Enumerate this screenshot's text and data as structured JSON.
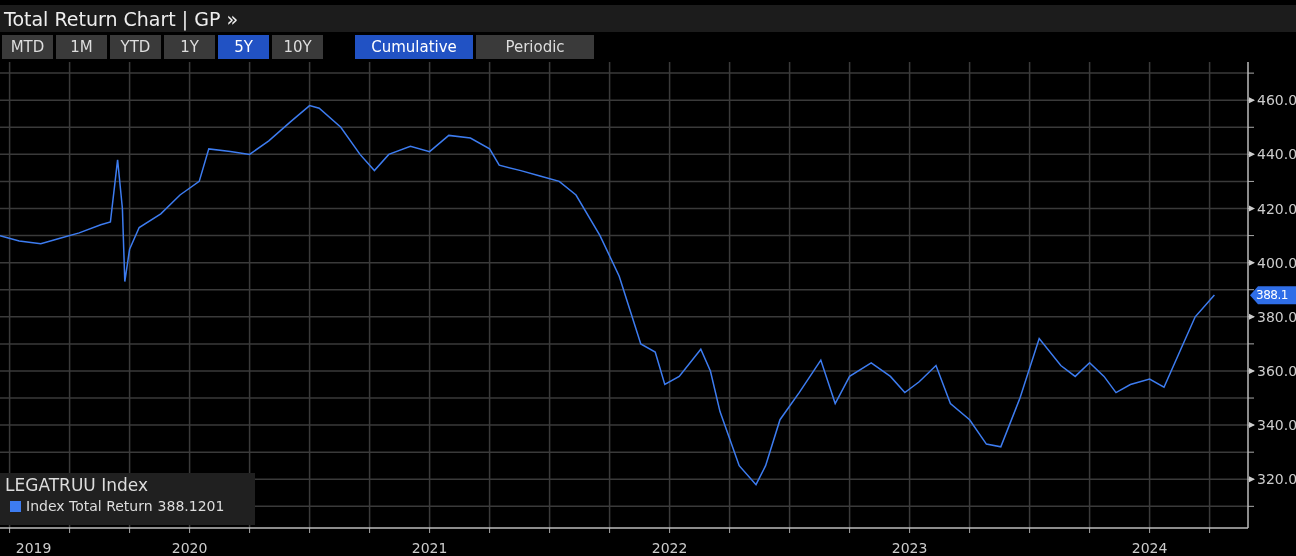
{
  "window": {
    "title": "Total Return Chart | GP »"
  },
  "periods": [
    {
      "label": "MTD",
      "selected": false
    },
    {
      "label": "1M",
      "selected": false
    },
    {
      "label": "YTD",
      "selected": false
    },
    {
      "label": "1Y",
      "selected": false
    },
    {
      "label": "5Y",
      "selected": true
    },
    {
      "label": "10Y",
      "selected": false
    }
  ],
  "modes": [
    {
      "label": "Cumulative",
      "selected": true
    },
    {
      "label": "Periodic",
      "selected": false
    }
  ],
  "legend": {
    "title": "LEGATRUU Index",
    "items": [
      {
        "value": "388.1201",
        "color": "#3d7cf0"
      }
    ]
  },
  "price_tag": "388.1",
  "chart": {
    "chart_data": {
      "type": "line",
      "x": [
        2019.21,
        2019.29,
        2019.38,
        2019.46,
        2019.54,
        2019.63,
        2019.67,
        2019.7,
        2019.72,
        2019.73,
        2019.75,
        2019.79,
        2019.88,
        2019.96,
        2020.04,
        2020.08,
        2020.17,
        2020.25,
        2020.33,
        2020.42,
        2020.5,
        2020.54,
        2020.63,
        2020.71,
        2020.77,
        2020.83,
        2020.92,
        2021.0,
        2021.08,
        2021.17,
        2021.25,
        2021.29,
        2021.38,
        2021.46,
        2021.54,
        2021.61,
        2021.71,
        2021.79,
        2021.88,
        2021.94,
        2021.98,
        2022.04,
        2022.13,
        2022.17,
        2022.21,
        2022.29,
        2022.36,
        2022.4,
        2022.46,
        2022.54,
        2022.63,
        2022.69,
        2022.75,
        2022.84,
        2022.92,
        2022.98,
        2023.04,
        2023.11,
        2023.17,
        2023.25,
        2023.32,
        2023.38,
        2023.46,
        2023.54,
        2023.63,
        2023.69,
        2023.75,
        2023.81,
        2023.86,
        2023.92,
        2024.0,
        2024.06,
        2024.13,
        2024.19,
        2024.27
      ],
      "series": [
        {
          "name": "Index Total Return",
          "color": "#3d7cf0",
          "values": [
            410,
            408,
            407,
            409,
            411,
            414,
            415,
            438,
            420,
            393,
            405,
            413,
            418,
            425,
            430,
            442,
            441,
            440,
            445,
            452,
            458,
            457,
            450,
            440,
            434,
            440,
            443,
            441,
            447,
            446,
            442,
            436,
            434,
            432,
            430,
            425,
            410,
            395,
            370,
            367,
            355,
            358,
            368,
            360,
            345,
            325,
            318,
            325,
            342,
            352,
            364,
            348,
            358,
            363,
            358,
            352,
            356,
            362,
            348,
            342,
            333,
            332,
            350,
            372,
            362,
            358,
            363,
            358,
            352,
            355,
            357,
            354,
            368,
            380,
            388
          ]
        }
      ],
      "xlim": [
        2019.21,
        2024.41
      ],
      "ylim": [
        302,
        473
      ],
      "grid": true,
      "xticks": [
        {
          "value": 2019.35,
          "label": "2019"
        },
        2020,
        2021,
        2022,
        2023,
        2024
      ],
      "yticks": [
        {
          "value": 460,
          "label": "460.0"
        },
        {
          "value": 440,
          "label": "440.0"
        },
        {
          "value": 420,
          "label": "420.0"
        },
        {
          "value": 400,
          "label": "400.0"
        },
        {
          "value": 380,
          "label": "380.0"
        },
        {
          "value": 360,
          "label": "360.0"
        },
        {
          "value": 340,
          "label": "340.0"
        },
        {
          "value": 320,
          "label": "320.0"
        }
      ]
    }
  }
}
